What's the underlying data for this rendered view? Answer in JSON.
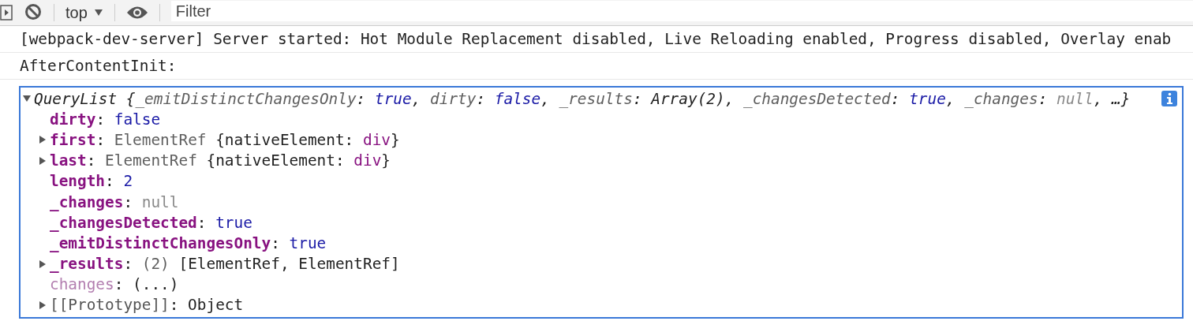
{
  "toolbar": {
    "context": "top",
    "filter": {
      "placeholder": "Filter"
    }
  },
  "messages": [
    {
      "text": "[webpack-dev-server] Server started: Hot Module Replacement disabled, Live Reloading enabled, Progress disabled, Overlay enab"
    },
    {
      "text": "AfterContentInit:"
    }
  ],
  "object": {
    "expanded": true,
    "summary": [
      {
        "kind": "text",
        "text": "QueryList {"
      },
      {
        "kind": "dim",
        "text": "_emitDistinctChangesOnly"
      },
      {
        "kind": "text",
        "text": ": "
      },
      {
        "kind": "bool",
        "text": "true"
      },
      {
        "kind": "text",
        "text": ", "
      },
      {
        "kind": "dim",
        "text": "dirty"
      },
      {
        "kind": "text",
        "text": ": "
      },
      {
        "kind": "bool",
        "text": "false"
      },
      {
        "kind": "text",
        "text": ", "
      },
      {
        "kind": "dim",
        "text": "_results"
      },
      {
        "kind": "text",
        "text": ": Array(2), "
      },
      {
        "kind": "dim",
        "text": "_changesDetected"
      },
      {
        "kind": "text",
        "text": ": "
      },
      {
        "kind": "bool",
        "text": "true"
      },
      {
        "kind": "text",
        "text": ", "
      },
      {
        "kind": "dim",
        "text": "_changes"
      },
      {
        "kind": "text",
        "text": ": "
      },
      {
        "kind": "null",
        "text": "null"
      },
      {
        "kind": "text",
        "text": ", …}"
      }
    ],
    "properties": [
      {
        "key": "dirty",
        "kind": "own",
        "value": [
          {
            "kind": "text",
            "text": ": "
          },
          {
            "kind": "bool",
            "text": "false"
          }
        ]
      },
      {
        "key": "first",
        "kind": "own",
        "expanded": false,
        "value": [
          {
            "kind": "text",
            "text": ": "
          },
          {
            "kind": "dim",
            "text": "ElementRef "
          },
          {
            "kind": "text",
            "text": "{nativeElement: "
          },
          {
            "kind": "tag",
            "text": "div"
          },
          {
            "kind": "text",
            "text": "}"
          }
        ]
      },
      {
        "key": "last",
        "kind": "own",
        "expanded": false,
        "value": [
          {
            "kind": "text",
            "text": ": "
          },
          {
            "kind": "dim",
            "text": "ElementRef "
          },
          {
            "kind": "text",
            "text": "{nativeElement: "
          },
          {
            "kind": "tag",
            "text": "div"
          },
          {
            "kind": "text",
            "text": "}"
          }
        ]
      },
      {
        "key": "length",
        "kind": "own",
        "value": [
          {
            "kind": "text",
            "text": ": "
          },
          {
            "kind": "bool",
            "text": "2"
          }
        ]
      },
      {
        "key": "_changes",
        "kind": "own",
        "value": [
          {
            "kind": "text",
            "text": ": "
          },
          {
            "kind": "null",
            "text": "null"
          }
        ]
      },
      {
        "key": "_changesDetected",
        "kind": "own",
        "value": [
          {
            "kind": "text",
            "text": ": "
          },
          {
            "kind": "bool",
            "text": "true"
          }
        ]
      },
      {
        "key": "_emitDistinctChangesOnly",
        "kind": "own",
        "value": [
          {
            "kind": "text",
            "text": ": "
          },
          {
            "kind": "bool",
            "text": "true"
          }
        ]
      },
      {
        "key": "_results",
        "kind": "own",
        "expanded": false,
        "value": [
          {
            "kind": "text",
            "text": ": "
          },
          {
            "kind": "dim",
            "text": "(2) "
          },
          {
            "kind": "text",
            "text": "[ElementRef, ElementRef]"
          }
        ]
      },
      {
        "key": "changes",
        "kind": "accessor",
        "value": [
          {
            "kind": "text",
            "text": ": (...)"
          }
        ]
      },
      {
        "key": "[[Prototype]]",
        "kind": "internal",
        "expanded": false,
        "value": [
          {
            "kind": "text",
            "text": ": Object"
          }
        ]
      }
    ]
  }
}
